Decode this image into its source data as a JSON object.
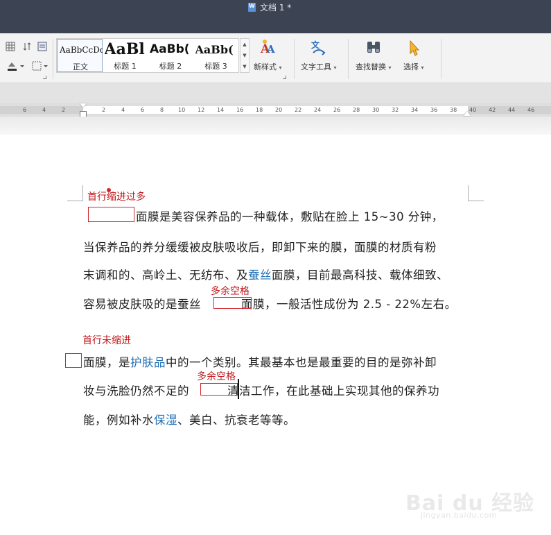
{
  "window": {
    "title": "文档 1 *"
  },
  "ribbon": {
    "styles": [
      {
        "sample": "AaBbCcDd",
        "label": "正文"
      },
      {
        "sample": "AaBl",
        "label": "标题 1"
      },
      {
        "sample": "AaBb(",
        "label": "标题 2"
      },
      {
        "sample": "AaBb(",
        "label": "标题 3"
      }
    ],
    "new_style": "新样式",
    "text_tools": "文字工具",
    "find_replace": "查找替换",
    "select": "选择",
    "dropdown_arrow": "▾"
  },
  "ruler": {
    "left_ticks": [
      "6",
      "4",
      "2"
    ],
    "right_ticks": [
      "2",
      "4",
      "6",
      "8",
      "10",
      "12",
      "14",
      "16",
      "18",
      "20",
      "22",
      "24",
      "26",
      "28",
      "30",
      "32",
      "34",
      "36",
      "38",
      "40",
      "42",
      "44",
      "46"
    ]
  },
  "document": {
    "annotations": {
      "indent_too_much": "首行缩进过多",
      "extra_space_1": "多余空格",
      "no_indent": "首行未缩进",
      "extra_space_2": "多余空格"
    },
    "para1": {
      "l1": "面膜是美容保养品的一种载体，敷贴在脸上 15~30 分钟，",
      "l2": "当保养品的养分缓缓被皮肤吸收后，即卸下来的膜，面膜的材质有粉",
      "l3a": "末调和的、高岭土、无纺布、及",
      "l3link": "蚕丝",
      "l3b": "面膜，目前最高科技、载体细致、",
      "l4a": "容易被皮肤吸的是蚕丝",
      "l4b": "面膜，一般活性成份为 2.5 - 22%左右。"
    },
    "para2": {
      "l1a": "面膜，是",
      "l1link": "护肤品",
      "l1b": "中的一个类别。其最基本也是最重要的目的是弥补卸",
      "l2a": "妆与洗脸仍然不足的",
      "l2b": "清洁工作，在此基础上实现其他的保养功",
      "l3a": "能，例如补水",
      "l3link": "保湿",
      "l3b": "、美白、抗衰老等等。"
    }
  },
  "watermark": {
    "logo": "Bai du 经验",
    "url": "jingyan.baidu.com"
  }
}
